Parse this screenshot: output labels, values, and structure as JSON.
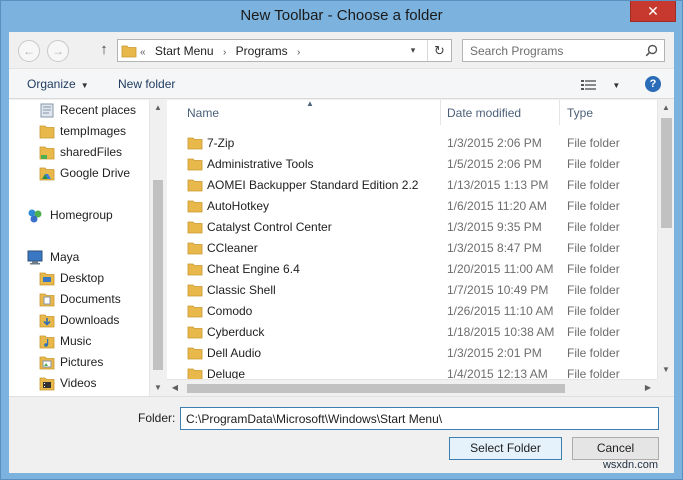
{
  "window": {
    "title": "New Toolbar - Choose a folder",
    "close_glyph": "✕"
  },
  "address": {
    "back_glyph": "←",
    "forward_glyph": "→",
    "up_glyph": "↑",
    "prefix": "«",
    "crumbs": [
      "Start Menu",
      "Programs"
    ],
    "crumb_sep": "›",
    "refresh_glyph": "↻",
    "dropdown_glyph": "▾"
  },
  "search": {
    "placeholder": "Search Programs"
  },
  "commands": {
    "organize": "Organize",
    "new_folder": "New folder",
    "help": "?",
    "caret": "▼"
  },
  "nav": {
    "items": [
      {
        "label": "Recent places",
        "icon": "recent-places-icon"
      },
      {
        "label": "tempImages",
        "icon": "folder-icon"
      },
      {
        "label": "sharedFiles",
        "icon": "shared-folder-icon"
      },
      {
        "label": "Google Drive",
        "icon": "google-drive-icon"
      },
      {
        "label": "Homegroup",
        "icon": "homegroup-icon"
      },
      {
        "label": "Maya",
        "icon": "computer-icon"
      },
      {
        "label": "Desktop",
        "icon": "desktop-folder-icon"
      },
      {
        "label": "Documents",
        "icon": "documents-folder-icon"
      },
      {
        "label": "Downloads",
        "icon": "downloads-folder-icon"
      },
      {
        "label": "Music",
        "icon": "music-folder-icon"
      },
      {
        "label": "Pictures",
        "icon": "pictures-folder-icon"
      },
      {
        "label": "Videos",
        "icon": "videos-folder-icon"
      }
    ]
  },
  "list": {
    "columns": [
      "Name",
      "Date modified",
      "Type"
    ],
    "rows": [
      {
        "name": "7-Zip",
        "date": "1/3/2015 2:06 PM",
        "type": "File folder"
      },
      {
        "name": "Administrative Tools",
        "date": "1/5/2015 2:06 PM",
        "type": "File folder"
      },
      {
        "name": "AOMEI Backupper Standard Edition 2.2",
        "date": "1/13/2015 1:13 PM",
        "type": "File folder"
      },
      {
        "name": "AutoHotkey",
        "date": "1/6/2015 11:20 AM",
        "type": "File folder"
      },
      {
        "name": "Catalyst Control Center",
        "date": "1/3/2015 9:35 PM",
        "type": "File folder"
      },
      {
        "name": "CCleaner",
        "date": "1/3/2015 8:47 PM",
        "type": "File folder"
      },
      {
        "name": "Cheat Engine 6.4",
        "date": "1/20/2015 11:00 AM",
        "type": "File folder"
      },
      {
        "name": "Classic Shell",
        "date": "1/7/2015 10:49 PM",
        "type": "File folder"
      },
      {
        "name": "Comodo",
        "date": "1/26/2015 11:10 AM",
        "type": "File folder"
      },
      {
        "name": "Cyberduck",
        "date": "1/18/2015 10:38 AM",
        "type": "File folder"
      },
      {
        "name": "Dell Audio",
        "date": "1/3/2015 2:01 PM",
        "type": "File folder"
      },
      {
        "name": "Deluge",
        "date": "1/4/2015 12:13 AM",
        "type": "File folder"
      }
    ]
  },
  "folder_field": {
    "label": "Folder:",
    "value": "C:\\ProgramData\\Microsoft\\Windows\\Start Menu\\"
  },
  "buttons": {
    "select": "Select Folder",
    "cancel": "Cancel"
  },
  "watermark": "wsxdn.com",
  "colors": {
    "frame": "#7bb3de",
    "close": "#c7392e",
    "folder_yellow": "#e8b84a",
    "accent_blue": "#3c7fb1"
  }
}
